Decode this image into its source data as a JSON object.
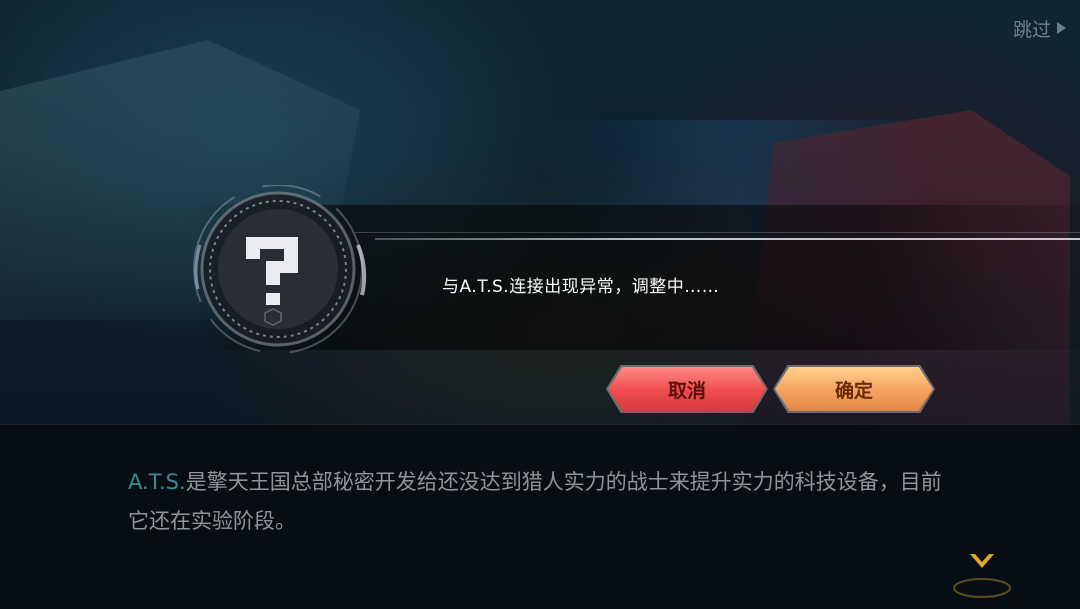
{
  "header": {
    "skip_label": "跳过"
  },
  "popup": {
    "message": "与A.T.S.连接出现异常，调整中……",
    "cancel_label": "取消",
    "confirm_label": "确定",
    "emblem_icon": "question-mark-icon"
  },
  "dialog": {
    "highlight": "A.T.S.",
    "text": "是擎天王国总部秘密开发给还没达到猎人实力的战士来提升实力的科技设备，目前它还在实验阶段。"
  },
  "colors": {
    "cancel": "#ee4b4d",
    "confirm": "#f4a15e",
    "highlight": "#3c8a92"
  }
}
